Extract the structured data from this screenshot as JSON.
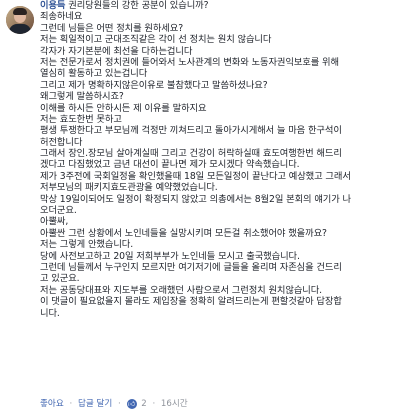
{
  "comment": {
    "author": "이용득",
    "lines": [
      "권리당원들의 강한 공분이 있습니까?",
      "죄송하네요",
      "그런데 님들은 어떤 정치를 원하세요?",
      "저는 획일적이고 군대조직같은 각이 선 정치는 원치 않습니다",
      "각자가 자기본분에 최선을 다하는겁니다",
      "저는 전문가로서 정치권에 들어와서 노사관계의 변화와 노동자권익보호를 위해",
      "열심히 활동하고 있는겁니다",
      "그리고 제가 명확하지않은이유로 불참했다고 말씀하셨나요?",
      "왜그렇게 말씀하시죠?",
      "이해를 하시든 안하시든 제 이유를 말하지요",
      "저는 효도한번 못하고",
      "평생 투쟁한다고 부모님께 걱정만 끼쳐드리고 돌아가시게해서 늘 마음 한구석이",
      "허전합니다",
      "그래서 장인.장모님 살아계실때 그리고 건강이 허락하실때 효도여행한번 해드리",
      "겠다고 다짐했었고 금년 대선이 끝나면 제가 모시겠다 약속했습니다.",
      "제가 3주전에 국회일정을 확인했을때 18일 모든일정이 끝난다고 예상했고 그래서",
      "저부모님의 패키지효도관광을 예약했었습니다.",
      "막상 19일이되어도 일정이 확정되지 않았고 의총에서는 8월2일 본회의 얘기가 나",
      "오더군요.",
      "아뿔싸,",
      "아뿔싼 그런 상황에서 노인네들을 실망시키며 모든걸 취소했어야 했을까요?",
      "저는 그렇게 안했습니다.",
      "당에 사전보고하고 20일 저희부부가 노인네들 모시고 출국했습니다.",
      "그런데 님들께서 누구인지 모르지만 여기저기에 글들을 올리며 자존심을 건드리",
      "고 있군요.",
      "저는 공동당대표와 지도부를 오래했던 사람으로서 그런정치 원치않습니다.",
      "이 댓글이 필요없을지 몰라도 제입장을 정확히 알려드리는게 편할것같아 답장합",
      "니다."
    ]
  },
  "actions": {
    "like": "좋아요",
    "reply": "답글 달기",
    "reaction_count": "2",
    "time": "16시간"
  },
  "colors": {
    "author": "#365899",
    "link": "#4267b2",
    "meta": "#90949c",
    "text": "#1d2129"
  },
  "icons": {
    "reaction": "thumbs-up-icon"
  }
}
